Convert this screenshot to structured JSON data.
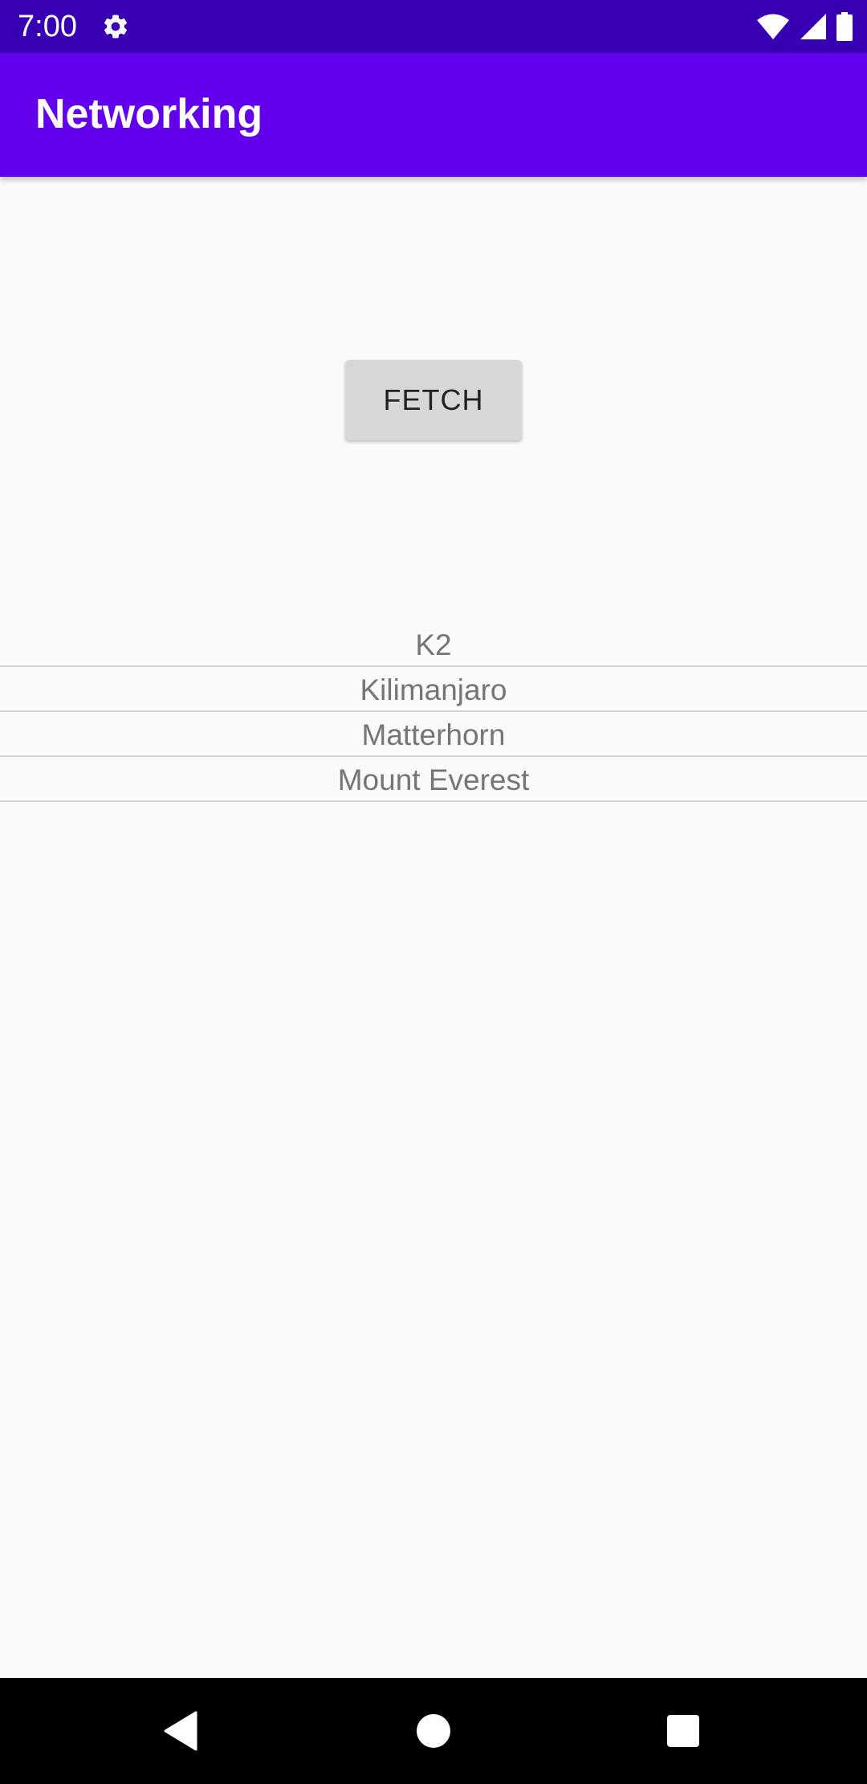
{
  "status_bar": {
    "time": "7:00",
    "background_color": "#3700b3",
    "icons": [
      "settings-gear-icon",
      "wifi-icon",
      "cell-signal-icon",
      "battery-icon"
    ]
  },
  "app_bar": {
    "title": "Networking",
    "background_color": "#6200ee"
  },
  "main": {
    "fetch_button_label": "FETCH",
    "items": [
      {
        "label": "K2"
      },
      {
        "label": "Kilimanjaro"
      },
      {
        "label": "Matterhorn"
      },
      {
        "label": "Mount Everest"
      }
    ]
  },
  "nav_bar": {
    "icons": [
      "back-icon",
      "home-icon",
      "recents-icon"
    ]
  }
}
